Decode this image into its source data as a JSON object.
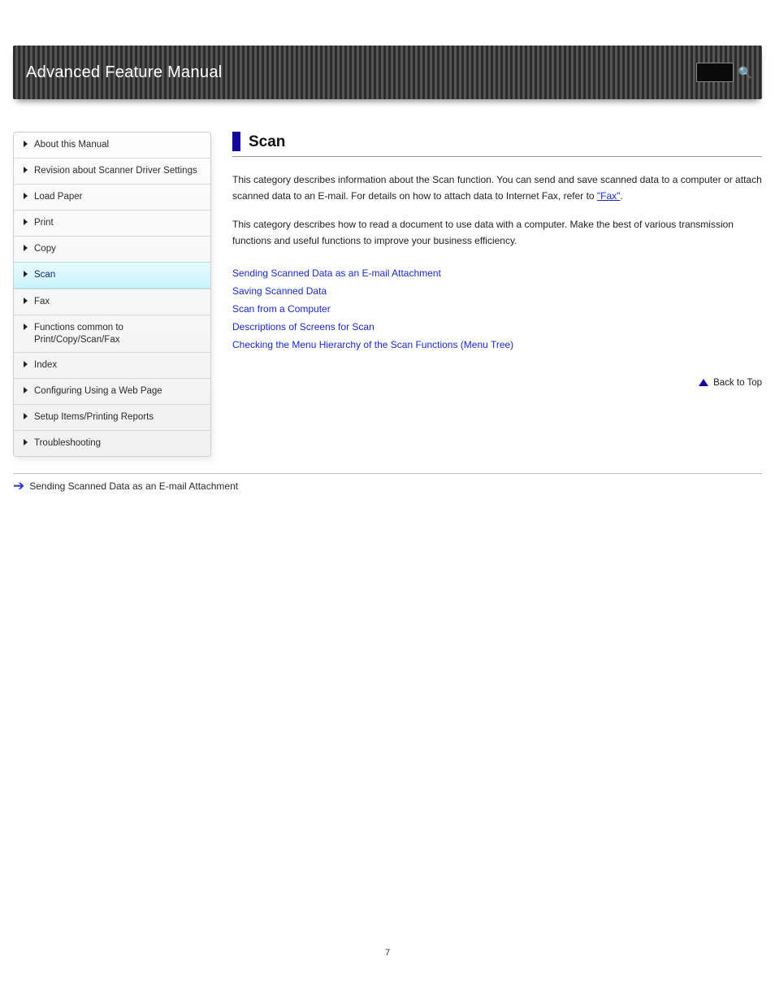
{
  "banner": {
    "title": "Advanced Feature Manual",
    "search_placeholder": ""
  },
  "sidebar": {
    "items": [
      {
        "label": "About this Manual",
        "active": false
      },
      {
        "label": "Revision about Scanner Driver Settings",
        "active": false
      },
      {
        "label": "Load Paper",
        "active": false
      },
      {
        "label": "Print",
        "active": false
      },
      {
        "label": "Copy",
        "active": false
      },
      {
        "label": "Scan",
        "active": true
      },
      {
        "label": "Fax",
        "active": false
      },
      {
        "label": "Functions common to Print/Copy/Scan/Fax",
        "active": false
      },
      {
        "label": "Index",
        "active": false
      },
      {
        "label": "Configuring Using a Web Page",
        "active": false
      },
      {
        "label": "Setup Items/Printing Reports",
        "active": false
      },
      {
        "label": "Troubleshooting",
        "active": false
      }
    ]
  },
  "main": {
    "section_title": "Scan",
    "paragraph_pre": "This category describes information about the Scan function. You can send and save scanned data to a computer or attach scanned data to an E-mail. For details on how to attach data to Internet Fax, refer to ",
    "paragraph_link": "\"Fax\"",
    "paragraph_post": ".",
    "needs_paragraph": "This category describes how to read a document to use data with a computer. Make the best of various transmission functions and useful functions to improve your business efficiency.",
    "links": [
      "Sending Scanned Data as an E-mail Attachment",
      "Saving Scanned Data",
      "Scan from a Computer",
      "Descriptions of Screens for Scan",
      "Checking the Menu Hierarchy of the Scan Functions (Menu Tree)"
    ],
    "back_to_top": "Back to Top"
  },
  "footer": {
    "next_label": "Sending Scanned Data as an E-mail Attachment"
  },
  "page_number": "7"
}
